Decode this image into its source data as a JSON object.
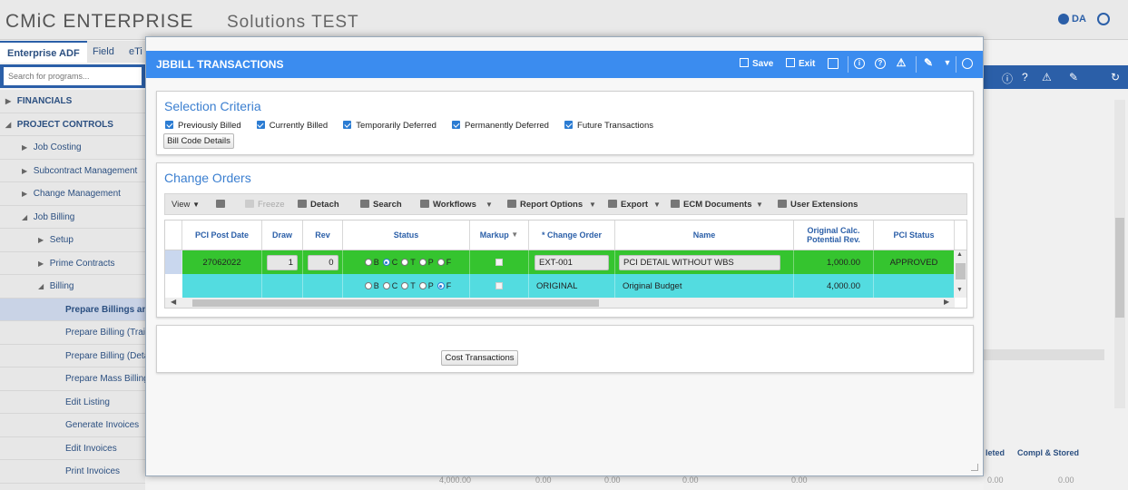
{
  "app": {
    "brand": "CMiC ENTERPRISE",
    "subtitle": "Solutions TEST",
    "user": "DA"
  },
  "nav_tabs": [
    "Enterprise ADF",
    "Field",
    "eTi"
  ],
  "search": {
    "placeholder": "Search for programs..."
  },
  "sidebar": [
    {
      "label": "FINANCIALS",
      "level": 0,
      "arrow": "▶",
      "category": true
    },
    {
      "label": "PROJECT CONTROLS",
      "level": 0,
      "arrow": "◢",
      "category": true
    },
    {
      "label": "Job Costing",
      "level": 1,
      "arrow": "▶"
    },
    {
      "label": "Subcontract Management",
      "level": 1,
      "arrow": "▶"
    },
    {
      "label": "Change Management",
      "level": 1,
      "arrow": "▶"
    },
    {
      "label": "Job Billing",
      "level": 1,
      "arrow": "◢"
    },
    {
      "label": "Setup",
      "level": 2,
      "arrow": "▶"
    },
    {
      "label": "Prime Contracts",
      "level": 2,
      "arrow": "▶"
    },
    {
      "label": "Billing",
      "level": 2,
      "arrow": "◢"
    },
    {
      "label": "Prepare Billings an",
      "level": 3,
      "arrow": "",
      "selected": true
    },
    {
      "label": "Prepare Billing (Trai",
      "level": 3,
      "arrow": ""
    },
    {
      "label": "Prepare Billing (Deta",
      "level": 3,
      "arrow": ""
    },
    {
      "label": "Prepare Mass Billing",
      "level": 3,
      "arrow": ""
    },
    {
      "label": "Edit Listing",
      "level": 3,
      "arrow": ""
    },
    {
      "label": "Generate Invoices",
      "level": 3,
      "arrow": ""
    },
    {
      "label": "Edit Invoices",
      "level": 3,
      "arrow": ""
    },
    {
      "label": "Print Invoices",
      "level": 3,
      "arrow": ""
    }
  ],
  "background": {
    "col_labels": [
      "leted",
      "Compl & Stored"
    ],
    "numbers": [
      "4,000.00",
      "0.00",
      "0.00",
      "0.00",
      "0.00",
      "0.00",
      "0.00"
    ]
  },
  "dialog": {
    "title": "JBBILL TRANSACTIONS",
    "save_label": "Save",
    "exit_label": "Exit",
    "selection": {
      "title": "Selection Criteria",
      "checkboxes": [
        {
          "label": "Previously Billed",
          "checked": true
        },
        {
          "label": "Currently Billed",
          "checked": true
        },
        {
          "label": "Temporarily Deferred",
          "checked": true
        },
        {
          "label": "Permanently Deferred",
          "checked": true
        },
        {
          "label": "Future Transactions",
          "checked": true
        }
      ],
      "bill_code_button": "Bill Code Details"
    },
    "change_orders": {
      "title": "Change Orders",
      "toolbar": {
        "view": "View",
        "freeze": "Freeze",
        "detach": "Detach",
        "search": "Search",
        "workflows": "Workflows",
        "report_options": "Report Options",
        "export": "Export",
        "ecm_documents": "ECM Documents",
        "user_extensions": "User Extensions"
      },
      "columns": [
        "PCI Post Date",
        "Draw",
        "Rev",
        "Status",
        "Markup",
        "* Change Order",
        "Name",
        "Original Calc. Potential Rev.",
        "PCI Status"
      ],
      "status_options": [
        "B",
        "C",
        "T",
        "P",
        "F"
      ],
      "rows": [
        {
          "pci_post_date": "27062022",
          "draw": "1",
          "rev": "0",
          "status_selected": "C",
          "change_order": "EXT-001",
          "name": "PCI DETAIL WITHOUT WBS",
          "original_calc": "1,000.00",
          "pci_status": "APPROVED",
          "color": "#35c42f"
        },
        {
          "pci_post_date": "",
          "draw": "",
          "rev": "",
          "status_selected": "F",
          "change_order": "ORIGINAL",
          "name": "Original Budget",
          "original_calc": "4,000.00",
          "pci_status": "",
          "color": "#53dce0"
        }
      ]
    },
    "cost_transactions_button": "Cost Transactions"
  }
}
